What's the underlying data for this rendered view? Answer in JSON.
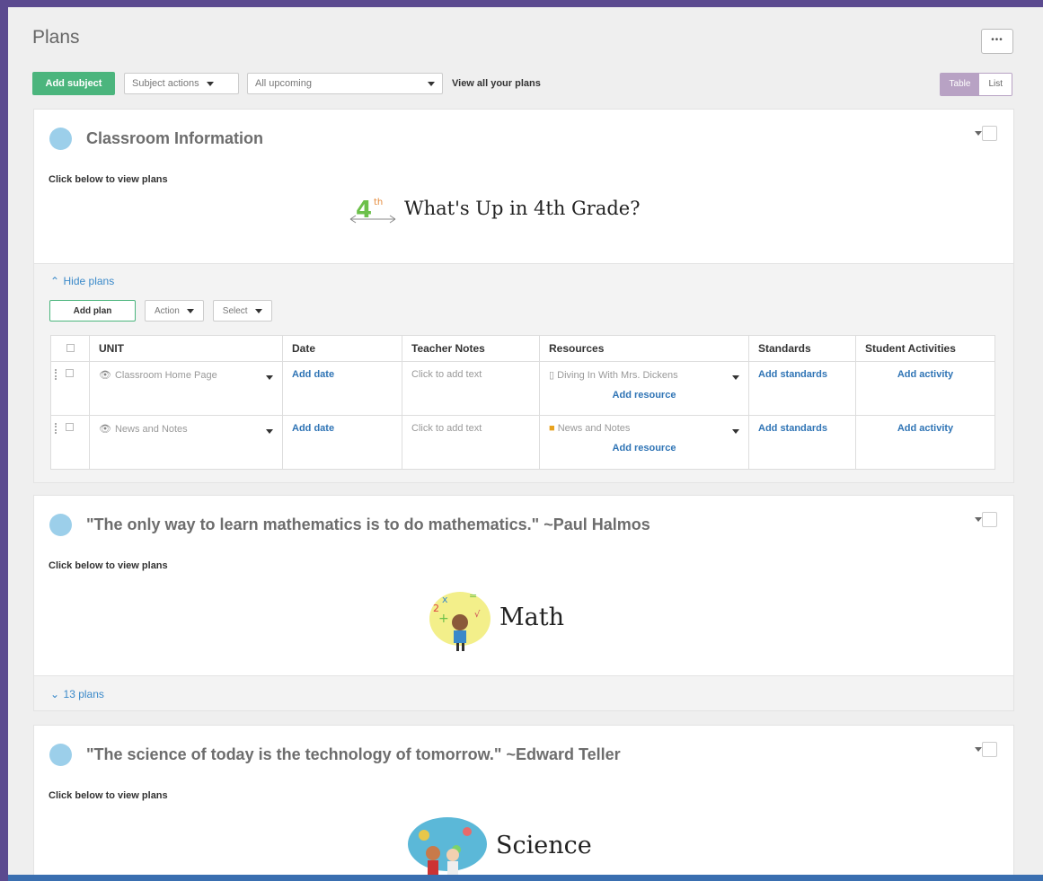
{
  "header": {
    "title": "Plans",
    "more_label": "•••"
  },
  "toolbar": {
    "add_subject": "Add subject",
    "subject_actions": "Subject actions",
    "filter": "All upcoming",
    "view_all": "View all your plans",
    "view_table": "Table",
    "view_list": "List"
  },
  "subjects": [
    {
      "title": "Classroom Information",
      "click_below": "Click below to view plans",
      "banner_text": "What's Up in 4th Grade?",
      "banner_badge": "4th",
      "toggle_label": "Hide plans",
      "controls": {
        "add_plan": "Add plan",
        "action": "Action",
        "select": "Select"
      },
      "columns": [
        "UNIT",
        "Date",
        "Teacher Notes",
        "Resources",
        "Standards",
        "Student Activities"
      ],
      "rows": [
        {
          "unit": "Classroom Home Page",
          "date": "Add date",
          "notes": "Click to add text",
          "resource": "Diving In With Mrs. Dickens",
          "add_resource": "Add resource",
          "standards": "Add standards",
          "activity": "Add activity"
        },
        {
          "unit": "News and Notes",
          "date": "Add date",
          "notes": "Click to add text",
          "resource": "News and Notes",
          "add_resource": "Add resource",
          "standards": "Add standards",
          "activity": "Add activity"
        }
      ]
    },
    {
      "title": "\"The only way to learn mathematics is to do mathematics.\" ~Paul Halmos",
      "click_below": "Click below to view plans",
      "banner_text": "Math",
      "toggle_label": "13 plans"
    },
    {
      "title": "\"The science of today is the technology of tomorrow.\"  ~Edward Teller",
      "click_below": "Click below to view plans",
      "banner_text": "Science"
    }
  ],
  "colors": {
    "accent_green": "#4bb57d",
    "link_blue": "#3a89c9",
    "dot_blue": "#9ccfea",
    "toggle_purple": "#b8a2c4"
  }
}
